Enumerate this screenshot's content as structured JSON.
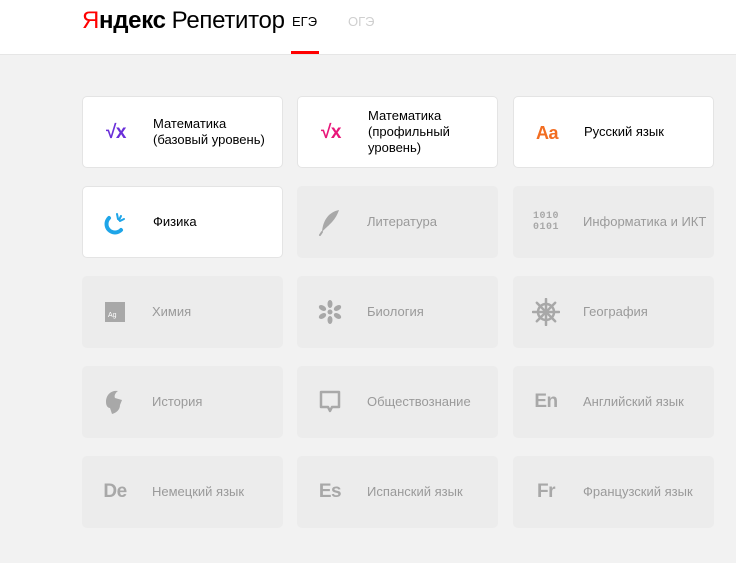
{
  "header": {
    "logo_brand_first": "Я",
    "logo_brand_rest": "ндекс",
    "logo_product": "Репетитор",
    "tabs": [
      {
        "label": "ЕГЭ",
        "active": true
      },
      {
        "label": "ОГЭ",
        "active": false
      }
    ]
  },
  "colors": {
    "accent": "#ff0000",
    "math_base": "#6a2fd9",
    "math_profile": "#e8177a",
    "russian": "#f26d21",
    "physics": "#1ea5e8",
    "disabled_icon": "#a8a8a8"
  },
  "subjects": [
    {
      "label": "Математика (базовый уровень)",
      "icon": "sqrt-x-icon",
      "glyph": "√x",
      "enabled": true
    },
    {
      "label": "Математика (профильный уровень)",
      "icon": "sqrt-x-icon",
      "glyph": "√x",
      "enabled": true
    },
    {
      "label": "Русский язык",
      "icon": "aa-letters-icon",
      "glyph": "Aa",
      "enabled": true
    },
    {
      "label": "Физика",
      "icon": "magnet-icon",
      "enabled": true
    },
    {
      "label": "Литература",
      "icon": "feather-icon",
      "enabled": false
    },
    {
      "label": "Информатика и ИКТ",
      "icon": "binary-code-icon",
      "glyph": "1010\n0101",
      "enabled": false
    },
    {
      "label": "Химия",
      "icon": "element-ag-icon",
      "glyph": "Ag",
      "enabled": false
    },
    {
      "label": "Биология",
      "icon": "flower-icon",
      "enabled": false
    },
    {
      "label": "География",
      "icon": "ship-wheel-icon",
      "enabled": false
    },
    {
      "label": "История",
      "icon": "spartan-helmet-icon",
      "enabled": false
    },
    {
      "label": "Обществознание",
      "icon": "speech-bubble-icon",
      "enabled": false
    },
    {
      "label": "Английский язык",
      "icon": "en-letters-icon",
      "glyph": "En",
      "enabled": false
    },
    {
      "label": "Немецкий язык",
      "icon": "de-letters-icon",
      "glyph": "De",
      "enabled": false
    },
    {
      "label": "Испанский язык",
      "icon": "es-letters-icon",
      "glyph": "Es",
      "enabled": false
    },
    {
      "label": "Французский язык",
      "icon": "fr-letters-icon",
      "glyph": "Fr",
      "enabled": false
    }
  ]
}
